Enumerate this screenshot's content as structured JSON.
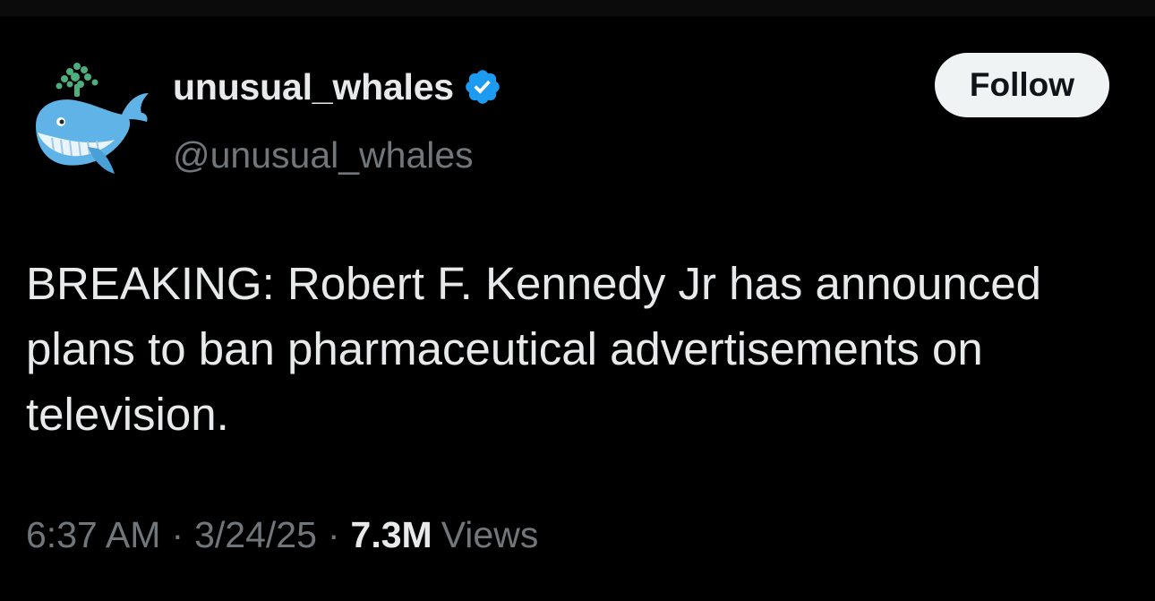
{
  "tweet": {
    "author": {
      "display_name": "unusual_whales",
      "handle": "@unusual_whales",
      "verified": true,
      "avatar_icon": "whale-icon"
    },
    "follow_label": "Follow",
    "text": "BREAKING: Robert F. Kennedy Jr has announced plans to ban pharmaceutical advertisements on television.",
    "time": "6:37 AM",
    "date": "3/24/25",
    "separator": "·",
    "views_count": "7.3M",
    "views_label": "Views"
  },
  "colors": {
    "background": "#000000",
    "primary_text": "#e7e9ea",
    "secondary_text": "#71767b",
    "verified_badge": "#1d9bf0",
    "follow_button_bg": "#eff3f4",
    "follow_button_text": "#0f1419"
  }
}
